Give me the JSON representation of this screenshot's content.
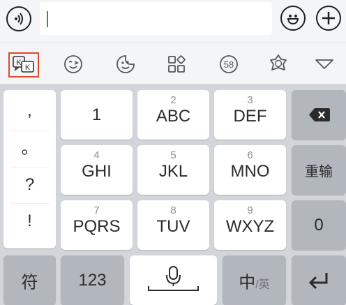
{
  "input_bar": {
    "text_value": ""
  },
  "toolbar": {
    "icons": [
      "kk-keyboard-icon",
      "emoji-face-icon",
      "sticker-icon",
      "apps-grid-icon",
      "number-58-icon",
      "badge-icon",
      "collapse-icon"
    ]
  },
  "keyboard": {
    "symbols": [
      ",",
      "。",
      "?",
      "!"
    ],
    "keys": {
      "k1": {
        "main": "1"
      },
      "k2": {
        "sub": "2",
        "main": "ABC"
      },
      "k3": {
        "sub": "3",
        "main": "DEF"
      },
      "k4": {
        "sub": "4",
        "main": "GHI"
      },
      "k5": {
        "sub": "5",
        "main": "JKL"
      },
      "k6": {
        "sub": "6",
        "main": "MNO"
      },
      "k7": {
        "sub": "7",
        "main": "PQRS"
      },
      "k8": {
        "sub": "8",
        "main": "TUV"
      },
      "k9": {
        "sub": "9",
        "main": "WXYZ"
      }
    },
    "retype_label": "重输",
    "zero_label": "0",
    "fu_label": "符",
    "num_label": "123",
    "lang_main": "中",
    "lang_sub": "/英"
  },
  "colors": {
    "accent_caret": "#1aad19",
    "highlight_border": "#e0472f"
  }
}
